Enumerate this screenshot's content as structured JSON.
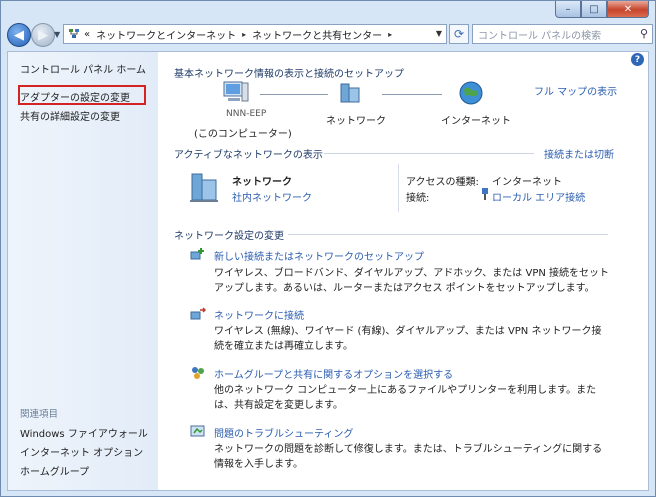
{
  "window": {
    "caption": {
      "minimize": "–",
      "maximize": "□",
      "close": "✕"
    }
  },
  "address": {
    "prefix": "«",
    "segments": [
      "ネットワークとインターネット",
      "ネットワークと共有センター"
    ],
    "separator": "▸"
  },
  "search": {
    "placeholder": "コントロール パネルの検索"
  },
  "sidebar": {
    "items": [
      {
        "label": "コントロール パネル ホーム"
      },
      {
        "label": "アダプターの設定の変更"
      },
      {
        "label": "共有の詳細設定の変更"
      }
    ],
    "related_heading": "関連項目",
    "related": [
      {
        "label": "Windows ファイアウォール"
      },
      {
        "label": "インターネット オプション"
      },
      {
        "label": "ホームグループ"
      }
    ]
  },
  "main": {
    "basic_title": "基本ネットワーク情報の表示と接続のセットアップ",
    "full_map": "フル マップの表示",
    "map": {
      "computer_name": "NNN-EEP",
      "computer_sub": "(このコンピューター)",
      "network": "ネットワーク",
      "internet": "インターネット"
    },
    "active_title": "アクティブなネットワークの表示",
    "connect_link": "接続または切断",
    "active": {
      "name": "ネットワーク",
      "type": "社内ネットワーク",
      "access_label": "アクセスの種類:",
      "access_value": "インターネット",
      "conn_label": "接続:",
      "conn_value": "ローカル エリア接続"
    },
    "change_title": "ネットワーク設定の変更",
    "tasks": [
      {
        "title": "新しい接続またはネットワークのセットアップ",
        "desc": "ワイヤレス、ブロードバンド、ダイヤルアップ、アドホック、または VPN 接続をセットアップします。あるいは、ルーターまたはアクセス ポイントをセットアップします。"
      },
      {
        "title": "ネットワークに接続",
        "desc": "ワイヤレス (無線)、ワイヤード (有線)、ダイヤルアップ、または VPN ネットワーク接続を確立または再確立します。"
      },
      {
        "title": "ホームグループと共有に関するオプションを選択する",
        "desc": "他のネットワーク コンピューター上にあるファイルやプリンターを利用します。または、共有設定を変更します。"
      },
      {
        "title": "問題のトラブルシューティング",
        "desc": "ネットワークの問題を診断して修復します。または、トラブルシューティングに関する情報を入手します。"
      }
    ]
  }
}
